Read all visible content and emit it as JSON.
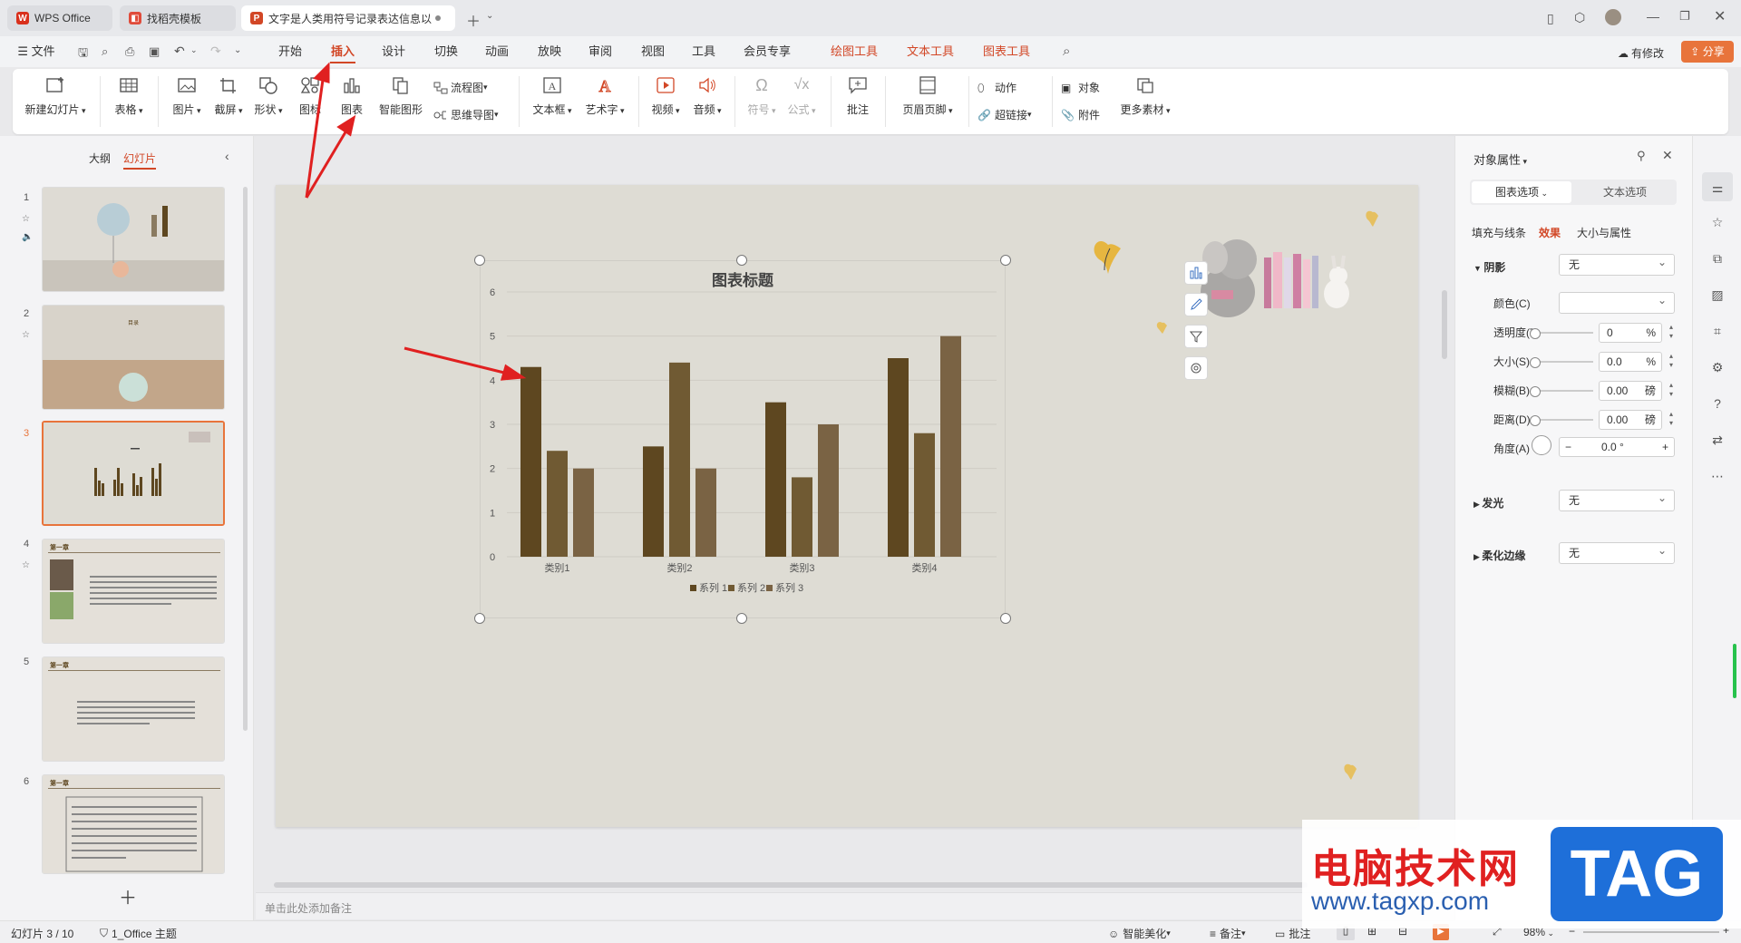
{
  "titlebar": {
    "tabs": [
      {
        "label": "WPS Office"
      },
      {
        "label": "找稻壳模板"
      },
      {
        "label": "文字是人类用符号记录表达信息以"
      }
    ]
  },
  "menubar": {
    "file": "文件",
    "items": [
      "开始",
      "插入",
      "设计",
      "切换",
      "动画",
      "放映",
      "审阅",
      "视图",
      "工具",
      "会员专享"
    ],
    "active": "插入",
    "context_items": [
      "绘图工具",
      "文本工具",
      "图表工具"
    ],
    "has_changes": "有修改",
    "share": "分享"
  },
  "ribbon": {
    "new_slide": "新建幻灯片",
    "table": "表格",
    "picture": "图片",
    "screenshot": "截屏",
    "shape": "形状",
    "icon": "图标",
    "chart": "图表",
    "smart_graphic": "智能图形",
    "flowchart": "流程图",
    "mindmap": "思维导图",
    "textbox": "文本框",
    "wordart": "艺术字",
    "video": "视频",
    "audio": "音频",
    "symbol": "符号",
    "formula": "公式",
    "comment": "批注",
    "header_footer": "页眉页脚",
    "action": "动作",
    "hyperlink": "超链接",
    "object": "对象",
    "attachment": "附件",
    "more_assets": "更多素材"
  },
  "leftpanel": {
    "tab_outline": "大纲",
    "tab_slides": "幻灯片",
    "slide_numbers": [
      "1",
      "2",
      "3",
      "4",
      "5",
      "6"
    ],
    "selected": "3",
    "thumb_texts": {
      "s2_title": "目录",
      "s4_title": "第一章",
      "s5_title": "第一章",
      "s6_title": "第一章"
    }
  },
  "chart_data": {
    "type": "bar",
    "title": "图表标题",
    "categories": [
      "类别1",
      "类别2",
      "类别3",
      "类别4"
    ],
    "series": [
      {
        "name": "系列 1",
        "values": [
          4.3,
          2.5,
          3.5,
          4.5
        ]
      },
      {
        "name": "系列 2",
        "values": [
          2.4,
          4.4,
          1.8,
          2.8
        ]
      },
      {
        "name": "系列 3",
        "values": [
          2.0,
          2.0,
          3.0,
          5.0
        ]
      }
    ],
    "ylim": [
      0,
      6
    ],
    "yticks": [
      "0",
      "1",
      "2",
      "3",
      "4",
      "5",
      "6"
    ],
    "colors": [
      "#5e4720",
      "#705a33",
      "#7a6344"
    ],
    "grid": true,
    "legend": "bottom"
  },
  "notes": {
    "placeholder": "单击此处添加备注"
  },
  "rightpanel": {
    "title": "对象属性",
    "tab_chart": "图表选项",
    "tab_text": "文本选项",
    "subtabs": [
      "填充与线条",
      "效果",
      "大小与属性"
    ],
    "active_subtab": "效果",
    "shadow": {
      "label": "阴影",
      "value": "无"
    },
    "color_label": "颜色(C)",
    "transparency": {
      "label": "透明度(T)",
      "value": "0",
      "unit": "%"
    },
    "size": {
      "label": "大小(S)",
      "value": "0.0",
      "unit": "%"
    },
    "blur": {
      "label": "模糊(B)",
      "value": "0.00",
      "unit": "磅"
    },
    "distance": {
      "label": "距离(D)",
      "value": "0.00",
      "unit": "磅"
    },
    "angle": {
      "label": "角度(A)",
      "value": "0.0 °"
    },
    "glow": {
      "label": "发光",
      "value": "无"
    },
    "soft_edge": {
      "label": "柔化边缘",
      "value": "无"
    }
  },
  "statusbar": {
    "slide_info": "幻灯片 3 / 10",
    "theme": "1_Office 主题",
    "beautify": "智能美化",
    "notes": "备注",
    "comments": "批注",
    "zoom": "98%"
  },
  "watermark": {
    "site_name": "电脑技术网",
    "site_url": "www.tagxp.com",
    "logo": "TAG"
  }
}
